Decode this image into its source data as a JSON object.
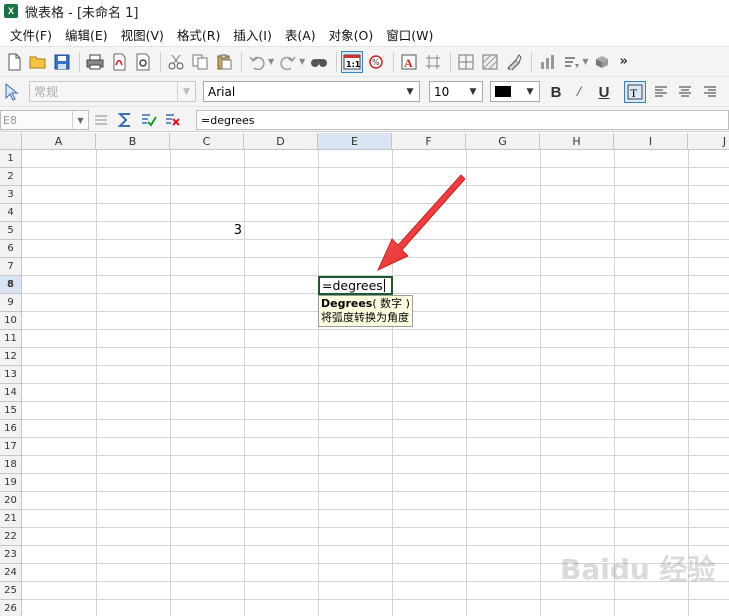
{
  "titlebar": {
    "icon_text": "X",
    "title": "微表格 - [未命名 1]"
  },
  "menu": [
    "文件(F)",
    "编辑(E)",
    "视图(V)",
    "格式(R)",
    "插入(I)",
    "表(A)",
    "对象(O)",
    "窗口(W)"
  ],
  "toolbar1_icons": [
    "new-icon",
    "open-icon",
    "save-icon",
    "print-icon",
    "pdf-icon",
    "print-preview-icon",
    "cut-icon",
    "copy-icon",
    "paste-icon",
    "undo-icon",
    "redo-icon",
    "find-icon",
    "show-formulas-icon",
    "zoom-icon",
    "text-frame-icon",
    "grid-lines-icon",
    "borders-icon",
    "pattern-icon",
    "format-painter-icon",
    "chart-icon",
    "sort-icon",
    "cube-icon"
  ],
  "toolbar1_more": "»",
  "toolbar2": {
    "style_value": "常规",
    "font_value": "Arial",
    "size_value": "10",
    "bold": "B",
    "italic": "/",
    "underline": "U",
    "colors": {
      "text_color": "#000000",
      "active_border": "#1c5a2e",
      "selection_header": "#d9e5f3",
      "arrow": "#e02020"
    }
  },
  "formula_bar": {
    "name_box": "E8",
    "content": "=degrees"
  },
  "columns": [
    "A",
    "B",
    "C",
    "D",
    "E",
    "F",
    "G",
    "H",
    "I",
    "J"
  ],
  "rows": [
    "1",
    "2",
    "3",
    "4",
    "5",
    "6",
    "7",
    "8",
    "9",
    "10",
    "11",
    "12",
    "13",
    "14",
    "15",
    "16",
    "17",
    "18",
    "19",
    "20",
    "21",
    "22",
    "23",
    "24",
    "25",
    "26"
  ],
  "selected_column": "E",
  "selected_row": "8",
  "cells": {
    "C5": "3",
    "E8": "=degrees"
  },
  "tooltip": {
    "fn_name": "Degrees",
    "fn_args": "( 数字 )",
    "description": "将弧度转换为角度"
  },
  "watermark": "Baidu 经验"
}
